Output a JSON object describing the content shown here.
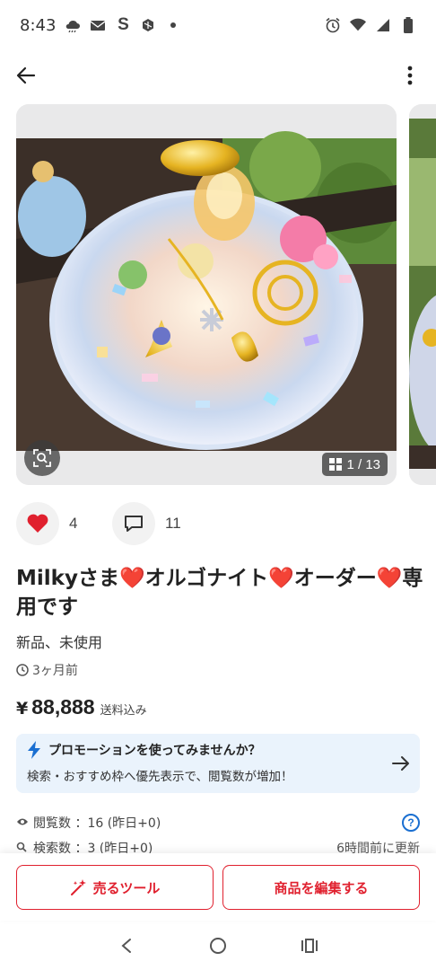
{
  "status": {
    "time": "8:43",
    "left_icons": [
      "cloud-icon",
      "mail-icon",
      "s-app-icon",
      "app-icon",
      "dot-icon"
    ],
    "right_icons": [
      "alarm-icon",
      "wifi-icon",
      "signal-icon",
      "battery-icon"
    ]
  },
  "appbar": {
    "back_icon": "arrow-left-icon",
    "menu_icon": "more-vertical-icon"
  },
  "gallery": {
    "counter": "1 / 13"
  },
  "actions": {
    "likes": "4",
    "comments": "11"
  },
  "product": {
    "title": "Milkyさま❤️オルゴナイト❤️オーダー❤️専用です",
    "condition": "新品、未使用",
    "posted": "3ヶ月前",
    "price_symbol": "¥",
    "price": "88,888",
    "shipping": "送料込み"
  },
  "promo": {
    "title": "プロモーションを使ってみませんか？",
    "desc": "検索・おすすめ枠へ優先表示で、閲覧数が増加！"
  },
  "stats": {
    "views": "閲覧数 ：16 (昨日+0)",
    "searches": "検索数 ：3 (昨日+0)",
    "updated": "6時間前に更新"
  },
  "bottom": {
    "sell_tool": "売るツール",
    "edit": "商品を編集する"
  },
  "colors": {
    "accent": "#e0202e",
    "promo_bg": "#eaf3fc",
    "link": "#1a6fd1"
  }
}
